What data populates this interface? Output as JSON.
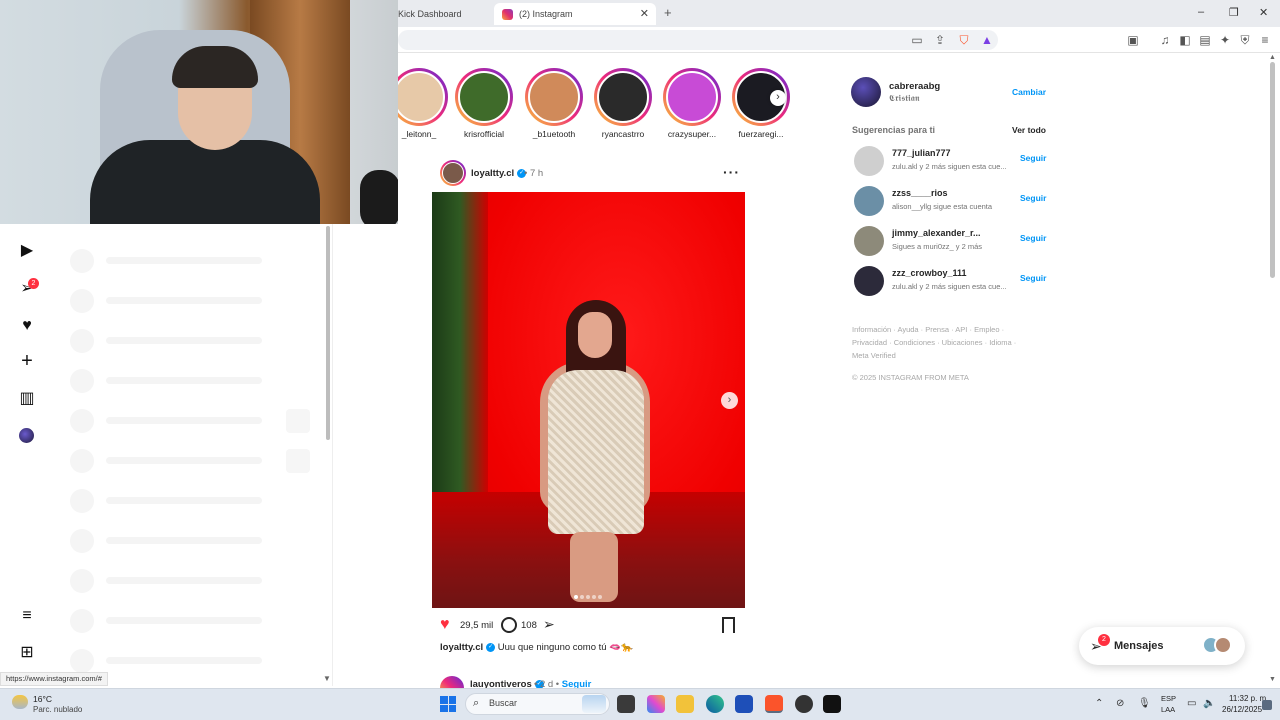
{
  "browser": {
    "tabs": [
      {
        "label": "Kick Dashboard"
      },
      {
        "label": "(2) Instagram"
      }
    ],
    "status_url": "https://www.instagram.com/#"
  },
  "nav": {
    "dm_badge": "2"
  },
  "stories": [
    {
      "name": "_leitonn_",
      "color": "#e7c9a8"
    },
    {
      "name": "krisrofficial",
      "color": "#3f6b2a"
    },
    {
      "name": "_b1uetooth",
      "color": "#d08a5a"
    },
    {
      "name": "ryancastrro",
      "color": "#2a2a2a"
    },
    {
      "name": "crazysuper...",
      "color": "#c84bd6"
    },
    {
      "name": "fuerzaregi...",
      "color": "#1b1b22"
    }
  ],
  "post": {
    "username": "loyaltty.cl",
    "time": "• 7 h",
    "likes": "29,5 mil",
    "comments": "108",
    "caption_user": "loyaltty.cl",
    "caption_text": "Uuu que ninguno como tú 🫦🐆"
  },
  "next_post": {
    "username": "lauyontiveros",
    "meta": "• 2 d •",
    "follow": "Seguir"
  },
  "sidebar": {
    "me_username": "cabreraabg",
    "me_name": "𝕮𝖗𝖎𝖘𝖙𝖎𝖆𝖓",
    "switch_label": "Cambiar",
    "suggestions_title": "Sugerencias para ti",
    "see_all": "Ver todo",
    "suggestions": [
      {
        "user": "777_julian777",
        "sub": "zulu.akl y 2 más siguen esta cue...",
        "follow": "Seguir",
        "color": "#cfcfcf"
      },
      {
        "user": "zzss____rios",
        "sub": "alison__yllg sigue esta cuenta",
        "follow": "Seguir",
        "color": "#6b8fa6"
      },
      {
        "user": "jimmy_alexander_r...",
        "sub": "Sigues a muri0zz_ y 2 más",
        "follow": "Seguir",
        "color": "#8d8a7a"
      },
      {
        "user": "zzz_crowboy_111",
        "sub": "zulu.akl y 2 más siguen esta cue...",
        "follow": "Seguir",
        "color": "#2c2a3a"
      }
    ],
    "footer_links": [
      "Información",
      "Ayuda",
      "Prensa",
      "API",
      "Empleo",
      "Privacidad",
      "Condiciones",
      "Ubicaciones",
      "Idioma",
      "Meta Verified"
    ],
    "copyright": "© 2025 INSTAGRAM FROM META"
  },
  "messages": {
    "label": "Mensajes",
    "badge": "2"
  },
  "taskbar": {
    "temp": "16°C",
    "weather": "Parc. nublado",
    "search_placeholder": "Buscar",
    "lang_1": "ESP",
    "lang_2": "LAA",
    "time": "11:32 p. m.",
    "date": "26/12/2025"
  }
}
